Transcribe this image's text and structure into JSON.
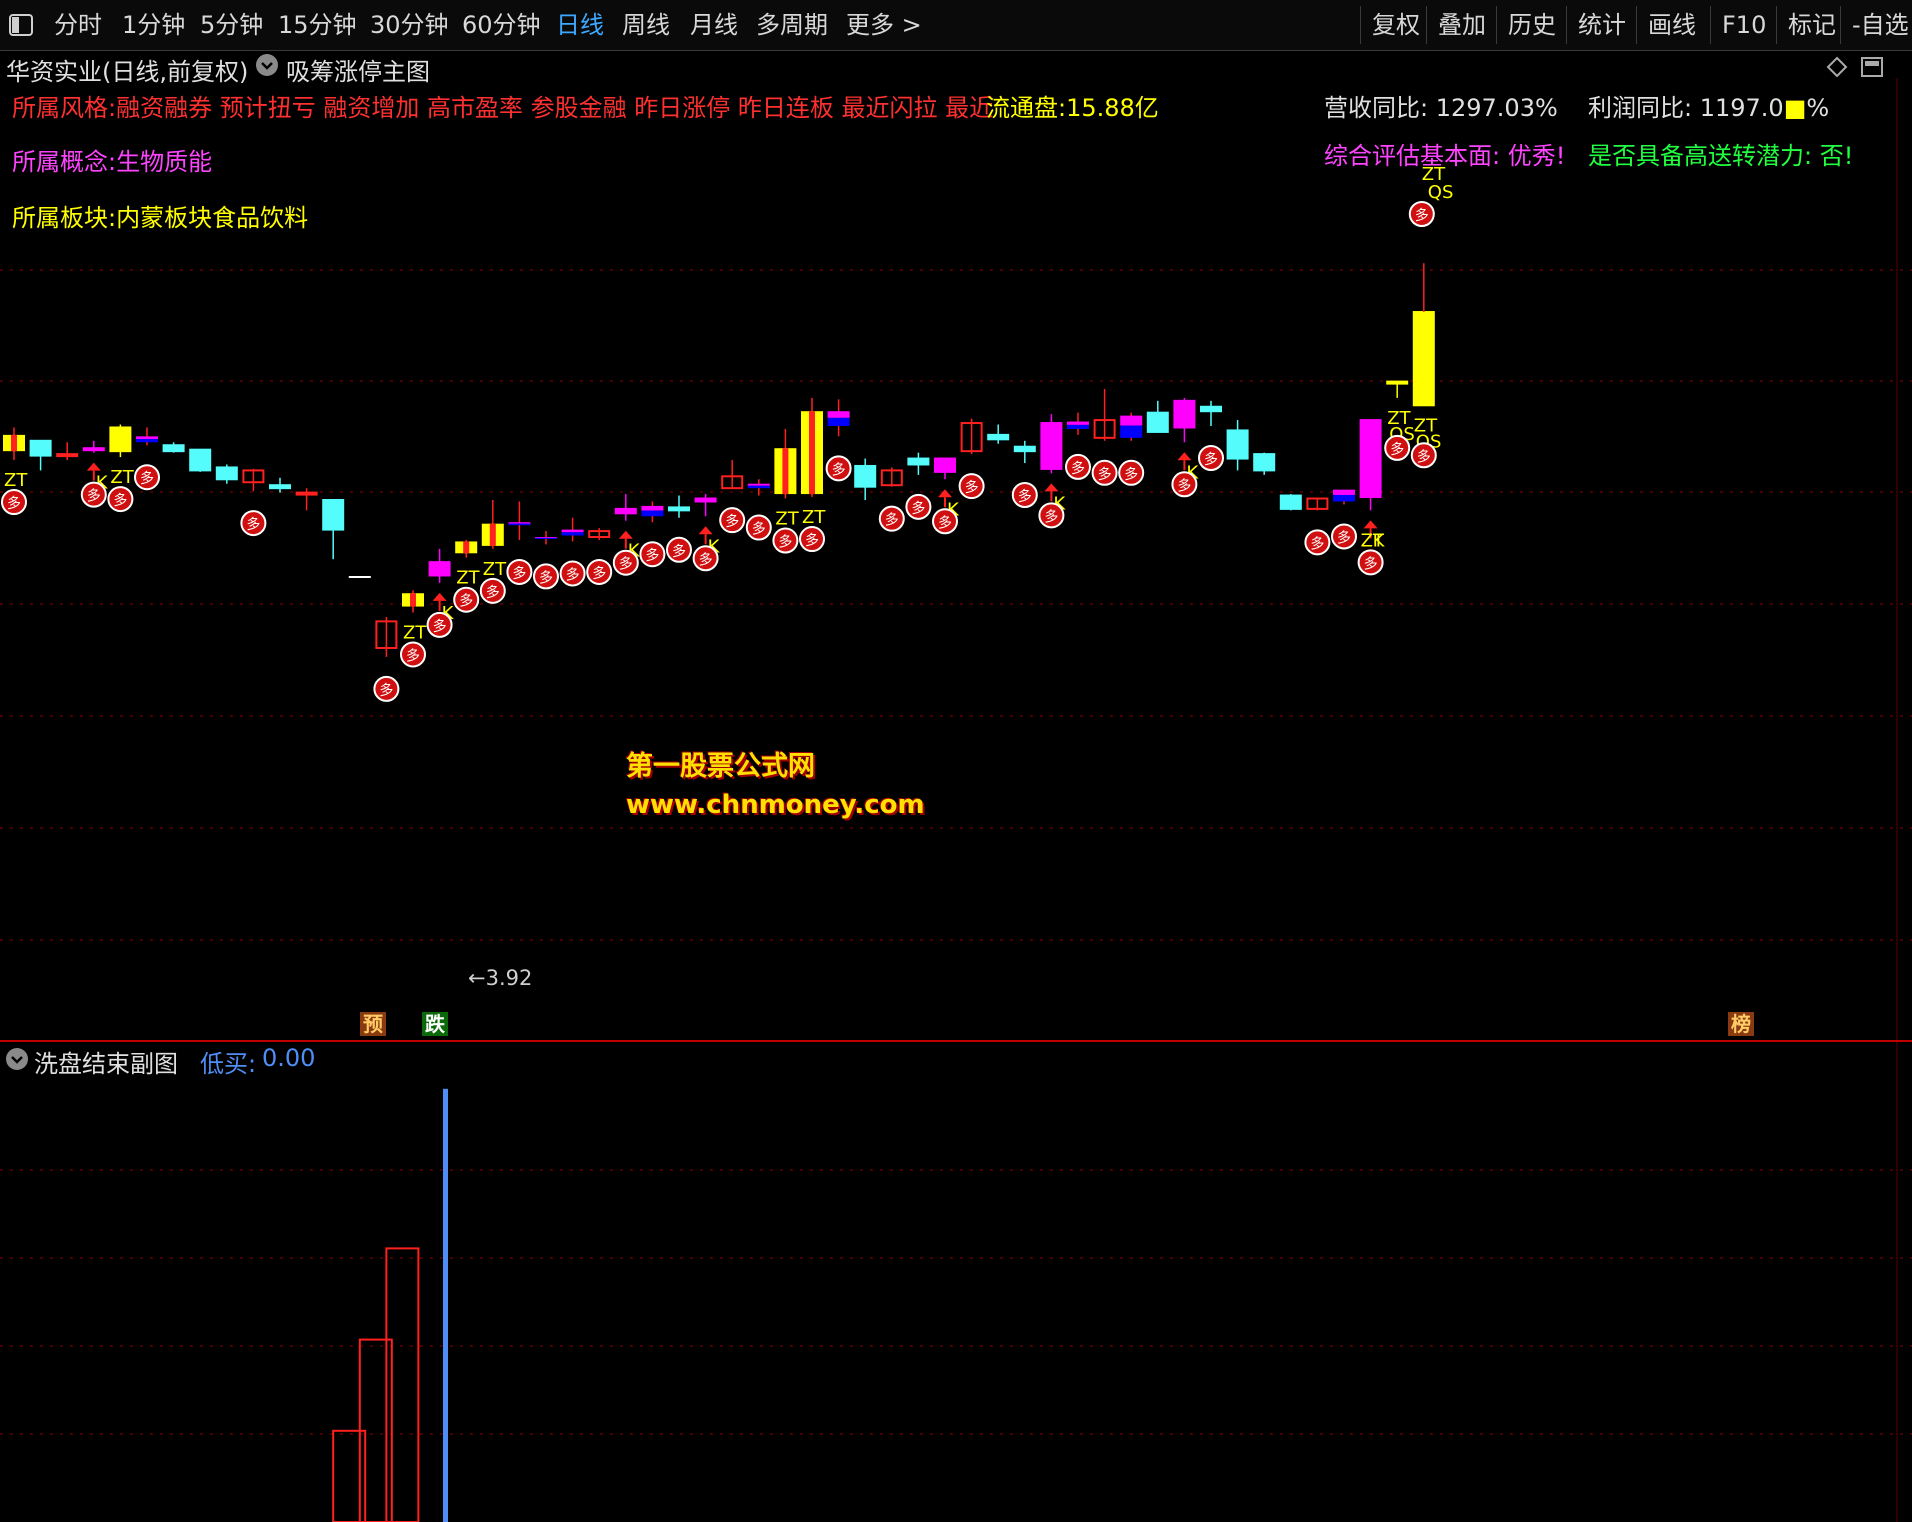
{
  "toolbar": {
    "items": [
      "分时",
      "1分钟",
      "5分钟",
      "15分钟",
      "30分钟",
      "60分钟",
      "日线",
      "周线",
      "月线",
      "多周期",
      "更多 >"
    ],
    "active_index": 6,
    "right_items": [
      "复权",
      "叠加",
      "历史",
      "统计",
      "画线",
      "F10",
      "标记",
      "-自选"
    ]
  },
  "header": {
    "stock_title": "华资实业(日线,前复权)",
    "main_indicator": "吸筹涨停主图",
    "sub_indicator": "洗盘结束副图",
    "sub_value_label": "低买:",
    "sub_value": "0.00"
  },
  "info": {
    "style_line": "所属风格:融资融券 预计扭亏 融资增加 高市盈率 参股金融 昨日涨停 昨日连板 最近闪拉 最近",
    "float_cap": "流通盘:15.88亿",
    "concept_line": "所属概念:生物质能",
    "sector_line": "所属板块:内蒙板块食品饮料",
    "revenue_yoy": "营收同比: 1297.03%",
    "profit_yoy": "利润同比: 1197.0",
    "profit_yoy_suffix": "%",
    "fundamental_eval": "综合评估基本面: 优秀!",
    "bonus_potential": "是否具备高送转潜力: 否!"
  },
  "chart": {
    "price_low_label": "←3.92",
    "watermark_title": "第一股票公式网",
    "watermark_url": "www.chnmoney.com",
    "bottom_tags": [
      "预",
      "跌",
      "榜"
    ],
    "marker_labels": {
      "zt": "ZT",
      "k": "K",
      "qs": "QS",
      "duo": "多"
    }
  },
  "colors": {
    "up_red": "#ff2020",
    "down_cyan": "#54fcfc",
    "magenta": "#ff00ff",
    "yellow": "#ffff00",
    "blue": "#0000ff",
    "grid_red": "#8b0000",
    "sub_bar_blue": "#4f8ef7",
    "active_tab": "#3da8ff"
  },
  "candles": [
    {
      "o": 4.44,
      "h": 4.49,
      "l": 4.27,
      "c": 4.33,
      "col": "redbox",
      "m": [
        "zt",
        "duo"
      ]
    },
    {
      "o": 4.3,
      "h": 4.37,
      "l": 4.2,
      "c": 4.4,
      "col": "cyan",
      "m": []
    },
    {
      "o": 4.31,
      "h": 4.39,
      "l": 4.27,
      "c": 4.3,
      "col": "redbox",
      "m": []
    },
    {
      "o": 4.35,
      "h": 4.4,
      "l": 4.32,
      "c": 4.35,
      "col": "magenta",
      "m": [
        "k",
        "duo"
      ]
    },
    {
      "o": 4.49,
      "h": 4.51,
      "l": 4.29,
      "c": 4.33,
      "col": "yellow",
      "m": [
        "zt",
        "duo"
      ]
    },
    {
      "o": 4.43,
      "h": 4.49,
      "l": 4.37,
      "c": 4.39,
      "col": "mb",
      "m": [
        "duo"
      ]
    },
    {
      "o": 4.37,
      "h": 4.39,
      "l": 4.32,
      "c": 4.33,
      "col": "cyan",
      "m": []
    },
    {
      "o": 4.34,
      "h": 4.34,
      "l": 4.19,
      "c": 4.2,
      "col": "cyan",
      "m": []
    },
    {
      "o": 4.22,
      "h": 4.24,
      "l": 4.11,
      "c": 4.14,
      "col": "cyan",
      "m": []
    },
    {
      "o": 4.12,
      "h": 4.21,
      "l": 4.06,
      "c": 4.2,
      "col": "redbox",
      "m": [
        "duo"
      ]
    },
    {
      "o": 4.1,
      "h": 4.15,
      "l": 4.05,
      "c": 4.08,
      "col": "cyan",
      "m": []
    },
    {
      "o": 4.04,
      "h": 4.08,
      "l": 3.93,
      "c": 4.05,
      "col": "redbox",
      "m": []
    },
    {
      "o": 4.0,
      "h": 4.0,
      "l": 3.6,
      "c": 3.8,
      "col": "cyan",
      "m": []
    },
    {
      "o": 3.48,
      "h": 3.48,
      "l": 3.48,
      "c": 3.48,
      "col": "flatwhite",
      "m": []
    },
    {
      "o": 3.0,
      "h": 3.21,
      "l": 2.94,
      "c": 3.18,
      "col": "redbox",
      "m": [
        "duo"
      ]
    },
    {
      "o": 3.28,
      "h": 3.39,
      "l": 3.24,
      "c": 3.37,
      "col": "redbox",
      "m": [
        "zt",
        "duo"
      ]
    },
    {
      "o": 3.58,
      "h": 3.67,
      "l": 3.44,
      "c": 3.49,
      "col": "magenta",
      "m": [
        "k",
        "duo"
      ]
    },
    {
      "o": 3.64,
      "h": 3.73,
      "l": 3.61,
      "c": 3.72,
      "col": "redbox",
      "m": [
        "zt",
        "duo"
      ]
    },
    {
      "o": 3.84,
      "h": 4.0,
      "l": 3.67,
      "c": 3.69,
      "col": "redbox",
      "m": [
        "zt",
        "duo"
      ]
    },
    {
      "o": 3.83,
      "h": 3.99,
      "l": 3.73,
      "c": 3.85,
      "col": "mb",
      "m": [
        "duo"
      ]
    },
    {
      "o": 3.75,
      "h": 3.79,
      "l": 3.7,
      "c": 3.75,
      "col": "mb",
      "m": [
        "duo"
      ]
    },
    {
      "o": 3.8,
      "h": 3.88,
      "l": 3.72,
      "c": 3.76,
      "col": "mb",
      "m": [
        "duo"
      ]
    },
    {
      "o": 3.79,
      "h": 3.81,
      "l": 3.73,
      "c": 3.75,
      "col": "redbox",
      "m": [
        "duo"
      ]
    },
    {
      "o": 3.94,
      "h": 4.04,
      "l": 3.86,
      "c": 3.91,
      "col": "magenta",
      "m": [
        "k",
        "duo"
      ]
    },
    {
      "o": 3.96,
      "h": 3.99,
      "l": 3.85,
      "c": 3.89,
      "col": "mb",
      "m": [
        "duo"
      ]
    },
    {
      "o": 3.93,
      "h": 4.03,
      "l": 3.88,
      "c": 3.95,
      "col": "cyan",
      "m": [
        "duo"
      ]
    },
    {
      "o": 4.01,
      "h": 4.04,
      "l": 3.89,
      "c": 3.99,
      "col": "magenta",
      "m": [
        "k",
        "duo"
      ]
    },
    {
      "o": 4.16,
      "h": 4.27,
      "l": 4.08,
      "c": 4.08,
      "col": "redbox",
      "m": [
        "duo"
      ]
    },
    {
      "o": 4.11,
      "h": 4.14,
      "l": 4.03,
      "c": 4.08,
      "col": "mb",
      "m": [
        "duo"
      ]
    },
    {
      "o": 4.35,
      "h": 4.48,
      "l": 4.01,
      "c": 4.04,
      "col": "redbox",
      "m": [
        "zt",
        "duo"
      ]
    },
    {
      "o": 4.6,
      "h": 4.69,
      "l": 4.02,
      "c": 4.04,
      "col": "redbox",
      "m": [
        "zt",
        "duo"
      ]
    },
    {
      "o": 4.6,
      "h": 4.68,
      "l": 4.43,
      "c": 4.5,
      "col": "mb",
      "m": [
        "duo"
      ]
    },
    {
      "o": 4.23,
      "h": 4.28,
      "l": 4.0,
      "c": 4.09,
      "col": "cyan",
      "m": []
    },
    {
      "o": 4.1,
      "h": 4.22,
      "l": 4.09,
      "c": 4.2,
      "col": "redbox",
      "m": [
        "duo"
      ]
    },
    {
      "o": 4.24,
      "h": 4.32,
      "l": 4.17,
      "c": 4.28,
      "col": "cyan",
      "m": [
        "duo"
      ]
    },
    {
      "o": 4.28,
      "h": 4.23,
      "l": 4.14,
      "c": 4.19,
      "col": "magenta",
      "m": [
        "k",
        "duo"
      ]
    },
    {
      "o": 4.33,
      "h": 4.55,
      "l": 4.31,
      "c": 4.52,
      "col": "redbox",
      "m": [
        "duo"
      ]
    },
    {
      "o": 4.41,
      "h": 4.51,
      "l": 4.38,
      "c": 4.44,
      "col": "cyan",
      "m": []
    },
    {
      "o": 4.33,
      "h": 4.4,
      "l": 4.25,
      "c": 4.36,
      "col": "cyan",
      "m": [
        "duo"
      ]
    },
    {
      "o": 4.52,
      "h": 4.58,
      "l": 4.18,
      "c": 4.21,
      "col": "magenta",
      "m": [
        "k",
        "duo"
      ]
    },
    {
      "o": 4.53,
      "h": 4.59,
      "l": 4.44,
      "c": 4.48,
      "col": "mb",
      "m": [
        "duo"
      ]
    },
    {
      "o": 4.54,
      "h": 4.75,
      "l": 4.4,
      "c": 4.42,
      "col": "redbox",
      "m": [
        "duo"
      ]
    },
    {
      "o": 4.57,
      "h": 4.59,
      "l": 4.4,
      "c": 4.42,
      "col": "mb",
      "m": [
        "duo"
      ]
    },
    {
      "o": 4.59,
      "h": 4.67,
      "l": 4.46,
      "c": 4.46,
      "col": "cyan",
      "m": []
    },
    {
      "o": 4.67,
      "h": 4.69,
      "l": 4.39,
      "c": 4.49,
      "col": "magenta",
      "m": [
        "k",
        "duo"
      ]
    },
    {
      "o": 4.6,
      "h": 4.67,
      "l": 4.5,
      "c": 4.63,
      "col": "cyan",
      "m": [
        "duo"
      ]
    },
    {
      "o": 4.47,
      "h": 4.54,
      "l": 4.2,
      "c": 4.28,
      "col": "cyan",
      "m": []
    },
    {
      "o": 4.31,
      "h": 4.32,
      "l": 4.17,
      "c": 4.2,
      "col": "cyan",
      "m": []
    },
    {
      "o": 4.03,
      "h": 4.04,
      "l": 3.93,
      "c": 3.94,
      "col": "cyan",
      "m": []
    },
    {
      "o": 4.01,
      "h": 4.01,
      "l": 3.93,
      "c": 3.94,
      "col": "redbox",
      "m": [
        "duo"
      ]
    },
    {
      "o": 4.07,
      "h": 4.04,
      "l": 3.97,
      "c": 3.99,
      "col": "mb",
      "m": [
        "duo"
      ]
    },
    {
      "o": 4.54,
      "h": 4.53,
      "l": 3.93,
      "c": 4.02,
      "col": "magenta",
      "m": [
        "zt",
        "k",
        "duo"
      ]
    },
    {
      "o": 4.8,
      "h": 4.8,
      "l": 4.69,
      "c": 4.8,
      "col": "yellow",
      "m": [
        "zt",
        "qs",
        "duo"
      ]
    },
    {
      "o": 5.27,
      "h": 5.27,
      "l": 4.64,
      "c": 4.64,
      "col": "yellow",
      "m": [
        "zt",
        "qs",
        "duo"
      ]
    }
  ],
  "sub_bars": [
    {
      "i": 11,
      "v": 16
    },
    {
      "i": 12,
      "v": 32
    },
    {
      "i": 13,
      "v": 48
    },
    {
      "i": 14,
      "v": 76,
      "blue": true
    }
  ]
}
